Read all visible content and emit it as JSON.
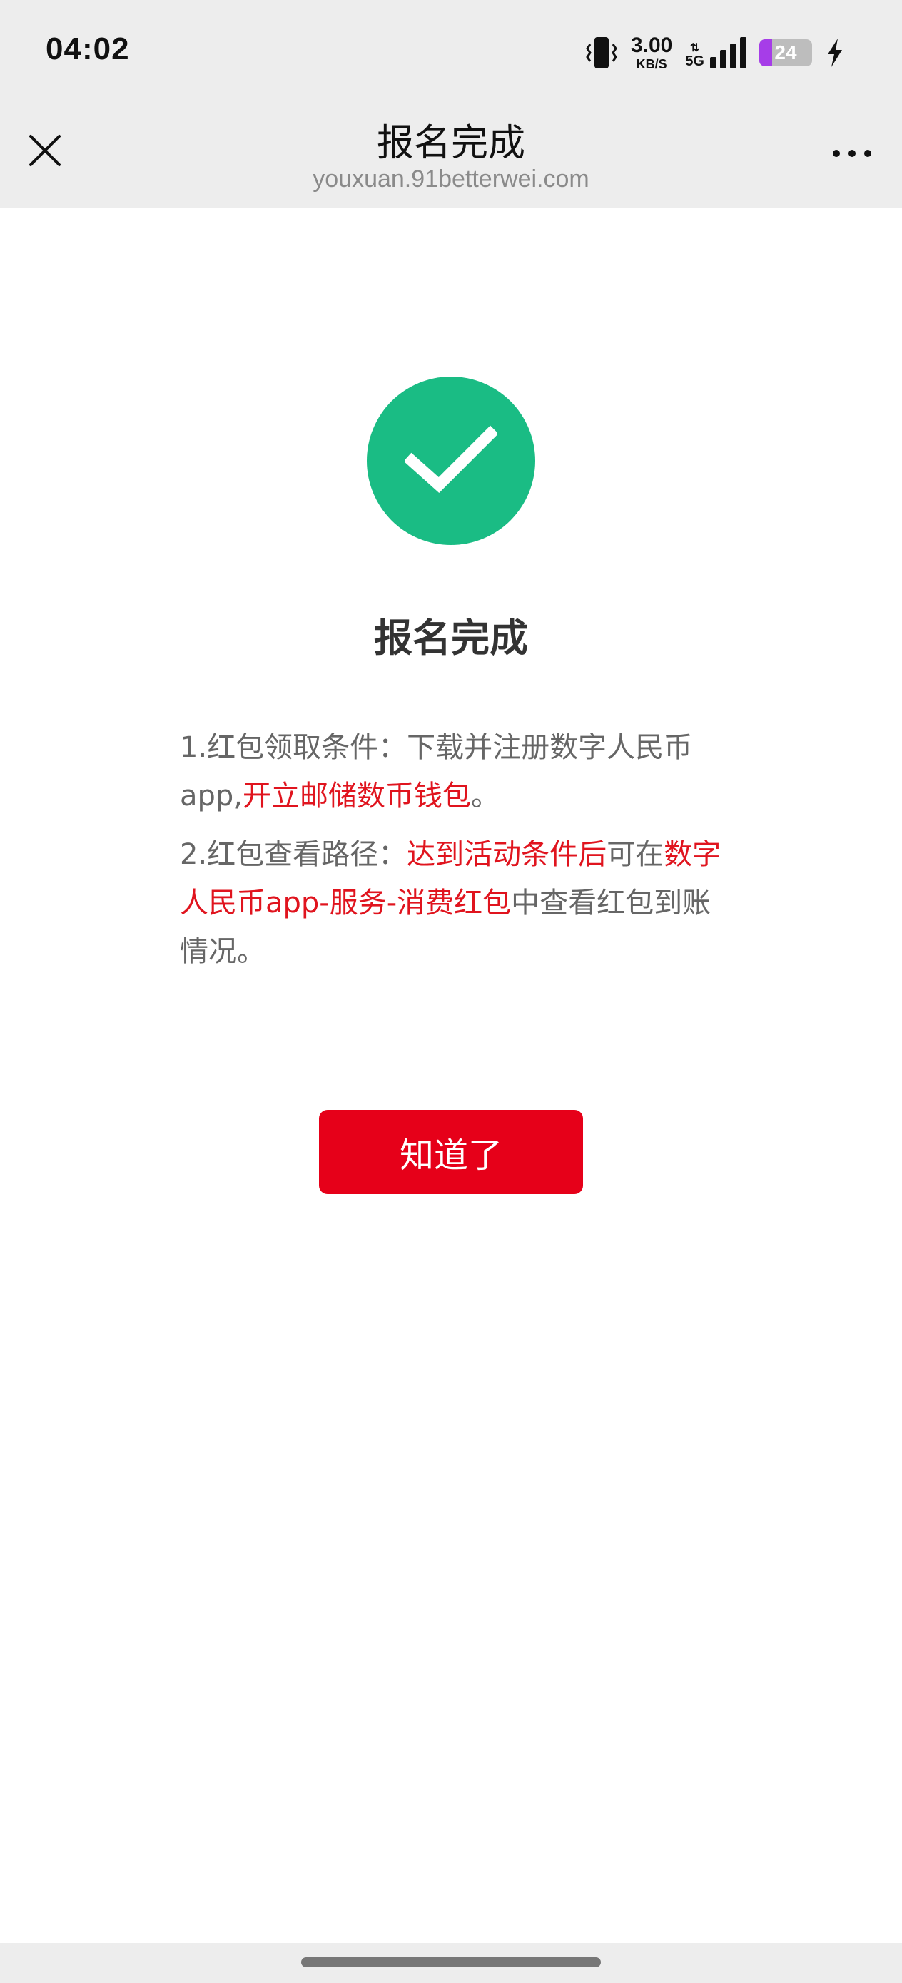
{
  "status_bar": {
    "time": "04:02",
    "net_speed": "3.00",
    "net_speed_unit": "KB/S",
    "network_arrows": "⇅",
    "network_type": "5G",
    "battery_level": "24",
    "battery_fraction": 0.24,
    "icons": [
      "vibrate-icon",
      "signal-icon",
      "battery-icon",
      "charging-bolt-icon"
    ]
  },
  "title_bar": {
    "title": "报名完成",
    "url": "youxuan.91betterwei.com",
    "icons": [
      "close-icon",
      "more-icon"
    ]
  },
  "main": {
    "status_icon": "check-icon",
    "status_color": "#1abc84",
    "result_title": "报名完成",
    "notes": [
      {
        "prefix": "1.红包领取条件：下载并注册数字人民币app,",
        "highlight": "开立邮储数币钱包",
        "suffix": "。"
      },
      {
        "prefix": "2.红包查看路径：",
        "highlight": "达到活动条件后",
        "middle": "可在",
        "highlight2": "数字人民币app-服务-消费红包",
        "suffix": "中查看红包到账情况。"
      }
    ],
    "highlight_color": "#e0141e",
    "ok_button_label": "知道了",
    "ok_button_color": "#e60019"
  }
}
